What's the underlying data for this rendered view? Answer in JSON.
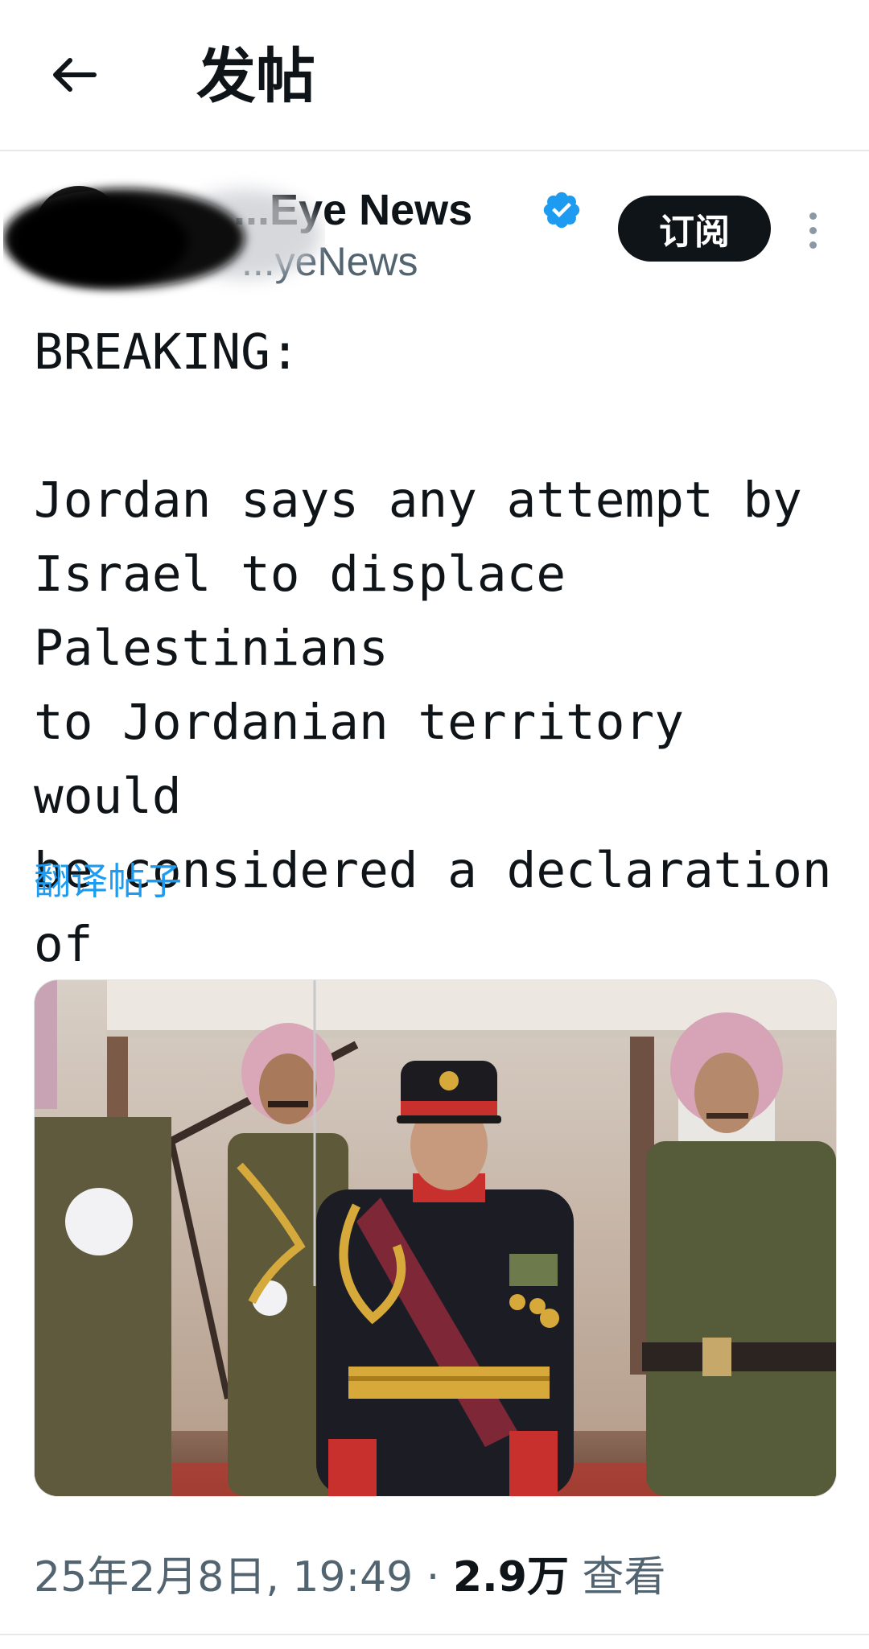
{
  "header": {
    "back_icon": "arrow-left-icon",
    "title": "发帖"
  },
  "author": {
    "display_name": "...Eye News",
    "handle": "...yeNews",
    "verified_icon": "verified-badge-icon",
    "verified_color": "#1d9bf0",
    "subscribe_label": "订阅",
    "more_icon": "more-vertical-icon"
  },
  "post": {
    "text": "BREAKING:\n\nJordan says any attempt by\nIsrael to displace Palestinians\nto Jordanian territory would\nbe considered a declaration of\nwar.",
    "translate_label": "翻译帖子"
  },
  "meta": {
    "timestamp": "25年2月8日, 19:49",
    "separator": " · ",
    "views_count": "2.9万",
    "views_label": " 查看"
  },
  "colors": {
    "accent": "#1d9bf0",
    "text_primary": "#0f1419",
    "text_secondary": "#536471"
  }
}
